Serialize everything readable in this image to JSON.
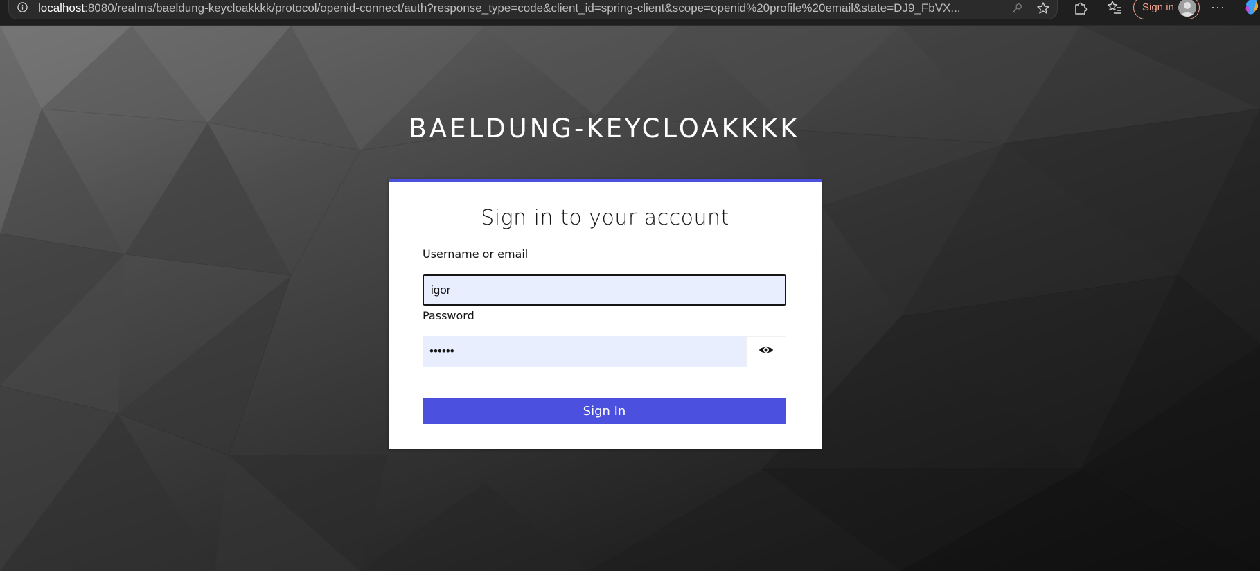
{
  "browser": {
    "url_host": "localhost",
    "url_rest": ":8080/realms/baeldung-keycloakkkk/protocol/openid-connect/auth?response_type=code&client_id=spring-client&scope=openid%20profile%20email&state=DJ9_FbVX...",
    "signin_label": "Sign in",
    "more_label": "···"
  },
  "page": {
    "realm_title": "BAELDUNG-KEYCLOAKKKK"
  },
  "login": {
    "title": "Sign in to your account",
    "username_label": "Username or email",
    "username_value": "igor",
    "password_label": "Password",
    "password_value": "••••••",
    "submit_label": "Sign In"
  },
  "colors": {
    "accent": "#4b50df",
    "input_autofill_bg": "#e8eefd"
  }
}
